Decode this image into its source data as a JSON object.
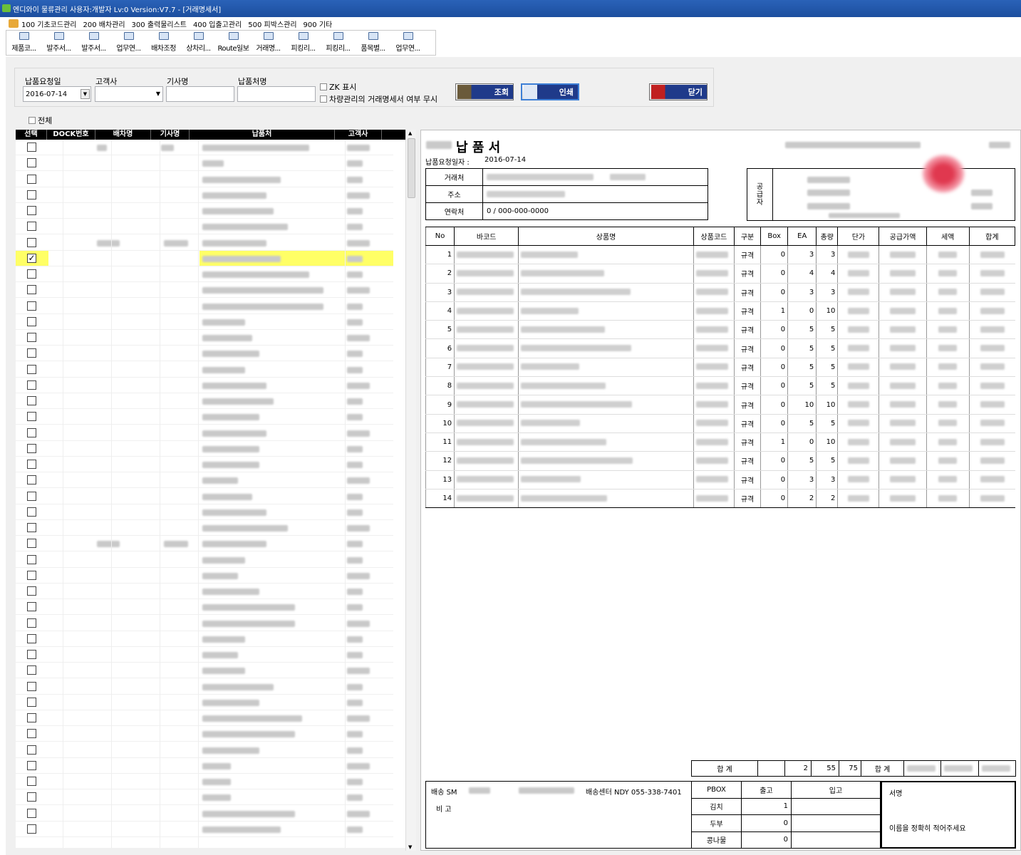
{
  "window": {
    "title": "엔디와이 물류관리 사용자:개발자 Lv:0 Version:V7.7 - [거래명세서]"
  },
  "menu": [
    "100 기초코드관리",
    "200 배차관리",
    "300 출력물리스트",
    "400 입출고관리",
    "500 피박스관리",
    "900 기타"
  ],
  "toolbar": [
    "제품코...",
    "발주서...",
    "발주서...",
    "업무연...",
    "배차조정",
    "상차리...",
    "Route일보",
    "거래명...",
    "피킹리...",
    "피킹리...",
    "품목별...",
    "업무연..."
  ],
  "filter": {
    "date_label": "납품요청일",
    "date_value": "2016-07-14",
    "customer_label": "고객사",
    "driver_label": "기사명",
    "shipto_label": "납품처명",
    "zk_label": "ZK 표시",
    "ignore_label": "차량관리의 거래명세서 여부 무시",
    "search_label": "조회",
    "print_label": "인쇄",
    "close_label": "닫기",
    "all_label": "전체"
  },
  "grid": {
    "columns": [
      "선택",
      "DOCK번호",
      "배차명",
      "기사명",
      "납품처",
      "고객사"
    ],
    "checked_row": 7,
    "row_count": 44
  },
  "doc": {
    "title": "납 품 서",
    "date_label": "납품요청일자 :",
    "date_value": "2016-07-14",
    "buyer_labels": [
      "거래처",
      "주소",
      "연락처"
    ],
    "contact_value": "0 / 000-000-0000",
    "supplier_label": "공급자",
    "columns": [
      "No",
      "바코드",
      "상품명",
      "상품코드",
      "구분",
      "Box",
      "EA",
      "총량",
      "단가",
      "공급가액",
      "세액",
      "합계"
    ],
    "items": [
      {
        "no": "1",
        "type": "규격",
        "box": "0",
        "ea": "3",
        "qty": "3"
      },
      {
        "no": "2",
        "type": "규격",
        "box": "0",
        "ea": "4",
        "qty": "4"
      },
      {
        "no": "3",
        "type": "규격",
        "box": "0",
        "ea": "3",
        "qty": "3"
      },
      {
        "no": "4",
        "type": "규격",
        "box": "1",
        "ea": "0",
        "qty": "10"
      },
      {
        "no": "5",
        "type": "규격",
        "box": "0",
        "ea": "5",
        "qty": "5"
      },
      {
        "no": "6",
        "type": "규격",
        "box": "0",
        "ea": "5",
        "qty": "5"
      },
      {
        "no": "7",
        "type": "규격",
        "box": "0",
        "ea": "5",
        "qty": "5"
      },
      {
        "no": "8",
        "type": "규격",
        "box": "0",
        "ea": "5",
        "qty": "5"
      },
      {
        "no": "9",
        "type": "규격",
        "box": "0",
        "ea": "10",
        "qty": "10"
      },
      {
        "no": "10",
        "type": "규격",
        "box": "0",
        "ea": "5",
        "qty": "5"
      },
      {
        "no": "11",
        "type": "규격",
        "box": "1",
        "ea": "0",
        "qty": "10"
      },
      {
        "no": "12",
        "type": "규격",
        "box": "0",
        "ea": "5",
        "qty": "5"
      },
      {
        "no": "13",
        "type": "규격",
        "box": "0",
        "ea": "3",
        "qty": "3"
      },
      {
        "no": "14",
        "type": "규격",
        "box": "0",
        "ea": "2",
        "qty": "2"
      }
    ],
    "total_label": "합 계",
    "total_box": "2",
    "total_ea": "55",
    "total_qty": "75",
    "total_label2": "합 계",
    "delivery_sm": "배송 SM",
    "center": "배송센터 NDY 055-338-7401",
    "remark": "비 고",
    "pbox_label": "PBOX",
    "out_label": "출고",
    "in_label": "입고",
    "pbox_rows": [
      {
        "name": "김치",
        "out": "1"
      },
      {
        "name": "두부",
        "out": "0"
      },
      {
        "name": "콩나물",
        "out": "0"
      }
    ],
    "sign_label": "서명",
    "sign_note": "이름을 정확히 적어주세요"
  }
}
